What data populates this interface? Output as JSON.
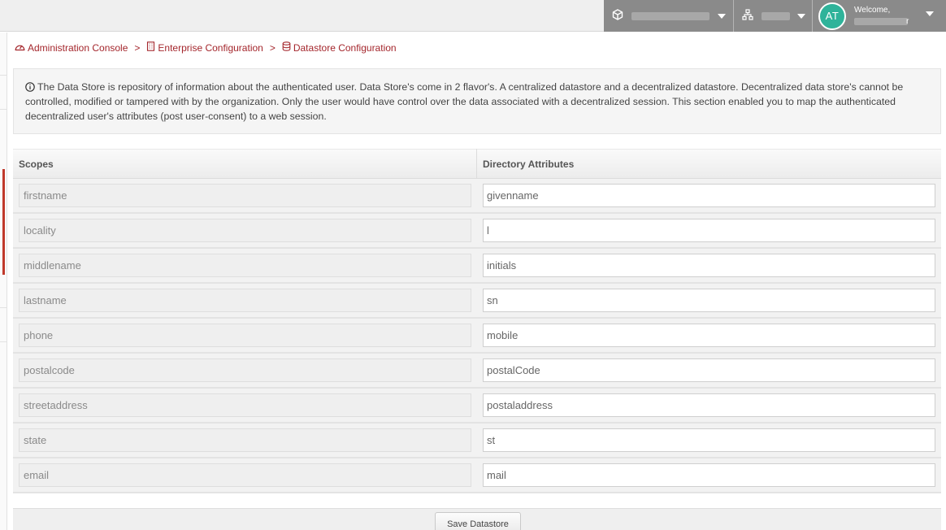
{
  "header": {
    "avatar_initials": "AT",
    "welcome_label": "Welcome,",
    "user_name_tail": "r",
    "colors": {
      "avatar": "#2fb39a",
      "header_gray": "#8a8a8a"
    }
  },
  "breadcrumb": {
    "items": [
      {
        "label": "Administration Console",
        "icon": "dashboard-icon"
      },
      {
        "label": "Enterprise Configuration",
        "icon": "building-icon"
      },
      {
        "label": "Datastore Configuration",
        "icon": "database-icon"
      }
    ],
    "separator": ">"
  },
  "info": {
    "text": "The Data Store is repository of information about the authenticated user. Data Store's come in 2 flavor's. A centralized datastore and a decentralized datastore. Decentralized data store's cannot be controlled, modified or tampered with by the organization. Only the user would have control over the data associated with a decentralized session. This section enabled you to map the authenticated decentralized user's attributes (post user-consent) to a web session.",
    "icon": "info-icon"
  },
  "table": {
    "headers": {
      "scopes": "Scopes",
      "attributes": "Directory Attributes"
    },
    "rows": [
      {
        "scope": "firstname",
        "attribute": "givenname"
      },
      {
        "scope": "locality",
        "attribute": "l"
      },
      {
        "scope": "middlename",
        "attribute": "initials"
      },
      {
        "scope": "lastname",
        "attribute": "sn"
      },
      {
        "scope": "phone",
        "attribute": "mobile"
      },
      {
        "scope": "postalcode",
        "attribute": "postalCode"
      },
      {
        "scope": "streetaddress",
        "attribute": "postaladdress"
      },
      {
        "scope": "state",
        "attribute": "st"
      },
      {
        "scope": "email",
        "attribute": "mail"
      }
    ]
  },
  "footer": {
    "save_label": "Save Datastore"
  },
  "accent_color": "#a4262c"
}
